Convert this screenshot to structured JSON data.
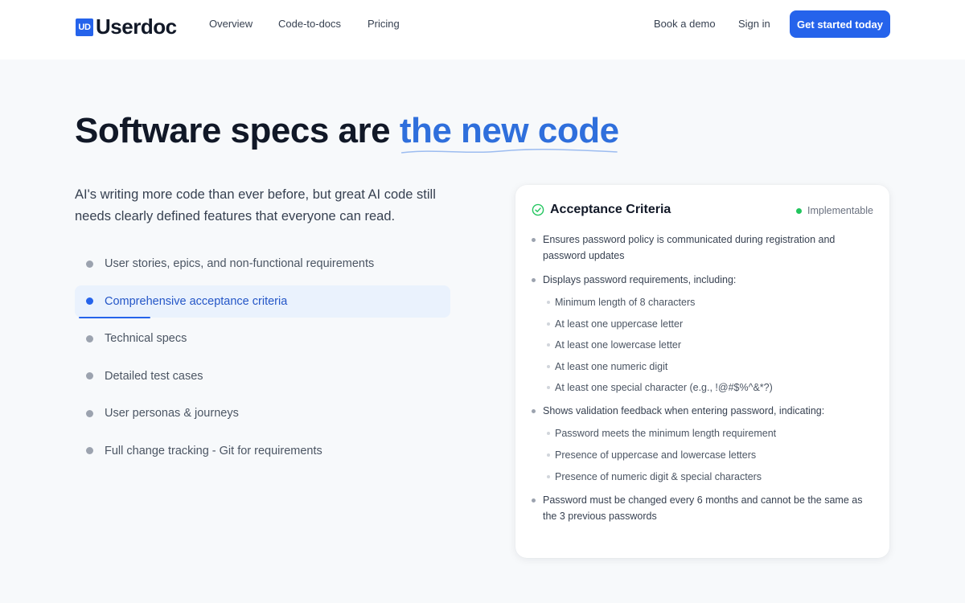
{
  "header": {
    "logo_mark": "UD",
    "logo_text": "Userdoc",
    "nav": [
      "Overview",
      "Code-to-docs",
      "Pricing"
    ],
    "book_demo": "Book a demo",
    "sign_in": "Sign in",
    "cta": "Get started today"
  },
  "hero": {
    "title_lead": "Software specs are ",
    "title_accent": "the new code",
    "lede": "AI's writing more code than ever before, but great AI code still needs clearly defined features that everyone can read."
  },
  "features": [
    {
      "label": "User stories, epics, and non-functional requirements",
      "active": false
    },
    {
      "label": "Comprehensive acceptance criteria",
      "active": true
    },
    {
      "label": "Technical specs",
      "active": false
    },
    {
      "label": "Detailed test cases",
      "active": false
    },
    {
      "label": "User personas & journeys",
      "active": false
    },
    {
      "label": "Full change tracking - Git for requirements",
      "active": false
    }
  ],
  "card": {
    "icon": "check-circle-icon",
    "title": "Acceptance Criteria",
    "status": "Implementable",
    "status_color": "#22c55e",
    "criteria": [
      {
        "text": "Ensures password policy is communicated during registration and password updates",
        "sub": []
      },
      {
        "text": "Displays password requirements, including:",
        "sub": [
          "Minimum length of 8 characters",
          "At least one uppercase letter",
          "At least one lowercase letter",
          "At least one numeric digit",
          "At least one special character (e.g., !@#$%^&*?)"
        ]
      },
      {
        "text": "Shows validation feedback when entering password, indicating:",
        "sub": [
          "Password meets the minimum length requirement",
          "Presence of uppercase and lowercase letters",
          "Presence of numeric digit & special characters"
        ]
      },
      {
        "text": "Password must be changed every 6 months and cannot be the same as the 3 previous passwords",
        "sub": []
      }
    ]
  },
  "colors": {
    "brand": "#2563eb",
    "accent_text": "#2f6fdc",
    "active_bg": "#eaf2fd"
  }
}
